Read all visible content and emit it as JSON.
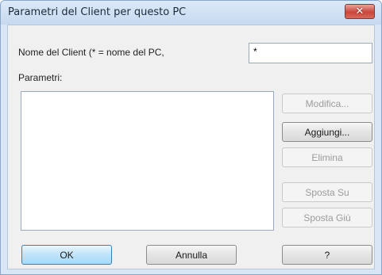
{
  "window": {
    "title": "Parametri del Client per questo PC",
    "close_icon": "close-icon"
  },
  "form": {
    "client_name_label": "Nome del Client (* = nome del PC,",
    "client_name_value": "*",
    "params_label": "Parametri:"
  },
  "side_buttons": {
    "modify": "Modifica...",
    "add": "Aggiungi...",
    "delete": "Elimina",
    "move_up": "Sposta Su",
    "move_down": "Sposta Giù"
  },
  "footer": {
    "ok": "OK",
    "cancel": "Annulla",
    "help": "?"
  },
  "colors": {
    "title_bar": "#c6d9ef",
    "close_button": "#c9463a",
    "default_button": "#a9d9f6"
  }
}
